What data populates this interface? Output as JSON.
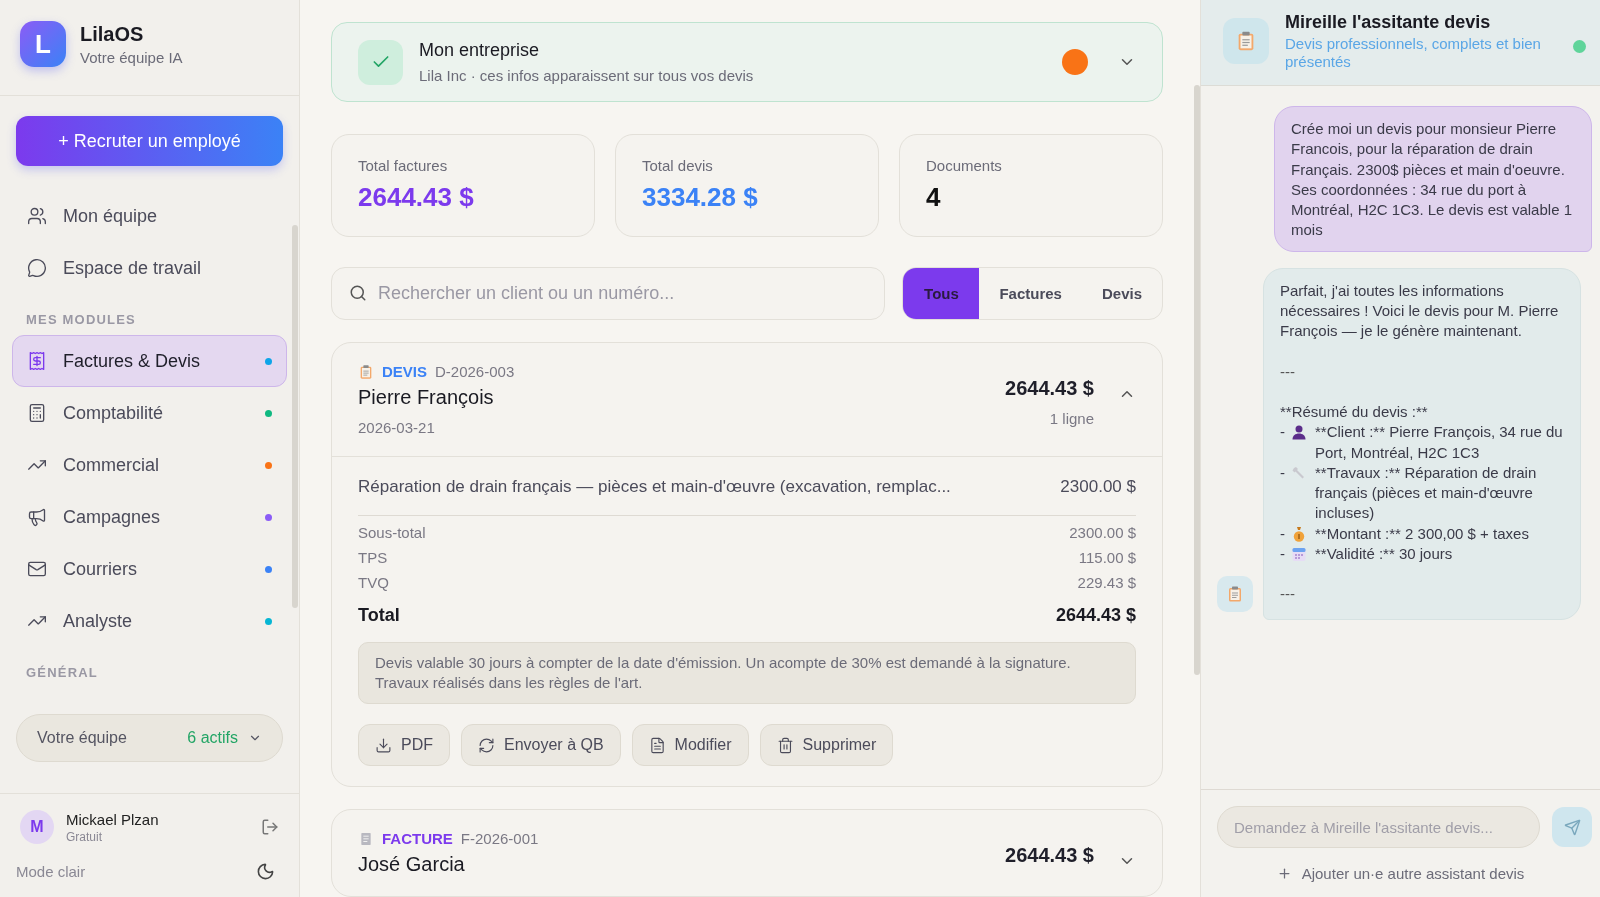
{
  "brand": {
    "logo_letter": "L",
    "name": "LilaOS",
    "tagline": "Votre équipe IA"
  },
  "recruit_button": "+ Recruter un employé",
  "nav": [
    {
      "kind": "users",
      "label": "Mon équipe"
    },
    {
      "kind": "chat",
      "label": "Espace de travail"
    }
  ],
  "modules": {
    "heading": "MES MODULES",
    "items": [
      {
        "kind": "invoice",
        "label": "Factures & Devis",
        "selected": true,
        "color": "#0ea5e9"
      },
      {
        "kind": "calculator",
        "label": "Comptabilité",
        "selected": false,
        "color": "#10b981"
      },
      {
        "kind": "trend",
        "label": "Commercial",
        "selected": false,
        "color": "#f97316"
      },
      {
        "kind": "megaphone",
        "label": "Campagnes",
        "selected": false,
        "color": "#8b5cf6"
      },
      {
        "kind": "mail",
        "label": "Courriers",
        "selected": false,
        "color": "#3b82f6"
      },
      {
        "kind": "trend",
        "label": "Analyste",
        "selected": false,
        "color": "#06b6d4"
      }
    ]
  },
  "general_heading": "GÉNÉRAL",
  "team": {
    "label": "Votre équipe",
    "count": "6 actifs"
  },
  "user": {
    "initial": "M",
    "name": "Mickael Plzan",
    "plan": "Gratuit"
  },
  "mode": {
    "label": "Mode clair"
  },
  "company": {
    "title": "Mon entreprise",
    "subtitle": "Lila Inc · ces infos apparaissent sur tous vos devis"
  },
  "stats": [
    {
      "label": "Total factures",
      "value": "2644.43 $",
      "color": "#7c3aed"
    },
    {
      "label": "Total devis",
      "value": "3334.28 $",
      "color": "#3b82f6"
    },
    {
      "label": "Documents",
      "value": "4",
      "color": "#111111"
    }
  ],
  "search": {
    "placeholder": "Rechercher un client ou un numéro..."
  },
  "filters": [
    {
      "label": "Tous",
      "selected": true
    },
    {
      "label": "Factures",
      "selected": false
    },
    {
      "label": "Devis",
      "selected": false
    }
  ],
  "documents": [
    {
      "kind": "devis",
      "type_label": "DEVIS",
      "number": "D-2026-003",
      "client": "Pierre François",
      "date": "2026-03-21",
      "amount": "2644.43 $",
      "lines_count": "1 ligne",
      "expanded": true,
      "lines": [
        {
          "description": "Réparation de drain français — pièces et main-d'œuvre (excavation, remplac...",
          "amount": "2300.00 $"
        }
      ],
      "totals": [
        {
          "label": "Sous-total",
          "value": "2300.00 $"
        },
        {
          "label": "TPS",
          "value": "115.00 $"
        },
        {
          "label": "TVQ",
          "value": "229.43 $"
        }
      ],
      "total": {
        "label": "Total",
        "value": "2644.43 $"
      },
      "note": "Devis valable 30 jours à compter de la date d'émission. Un acompte de 30% est demandé à la signature. Travaux réalisés dans les règles de l'art.",
      "actions": [
        {
          "kind": "download",
          "label": "PDF"
        },
        {
          "kind": "refresh",
          "label": "Envoyer à QB"
        },
        {
          "kind": "file",
          "label": "Modifier"
        },
        {
          "kind": "trash",
          "label": "Supprimer"
        }
      ]
    },
    {
      "kind": "facture",
      "type_label": "FACTURE",
      "number": "F-2026-001",
      "client": "José Garcia",
      "amount": "2644.43 $",
      "expanded": false
    }
  ],
  "assistant": {
    "name": "Mireille l'assitante devis",
    "subtitle": "Devis professionnels, complets et bien présentés",
    "online": true
  },
  "messages": [
    {
      "kind": "user",
      "text": "Crée moi un devis pour monsieur Pierre Francois, pour la réparation de drain Français. 2300$ pièces et main d'oeuvre. Ses coordonnées : 34 rue du port à Montréal, H2C 1C3. Le devis est valable 1 mois"
    },
    {
      "kind": "assistant",
      "blocks": [
        {
          "kind": "text",
          "text": "Parfait, j'ai toutes les informations nécessaires ! Voici le devis pour M. Pierre François — je le génère maintenant."
        },
        {
          "kind": "rule",
          "text": "---"
        },
        {
          "kind": "text",
          "text": "**Résumé du devis :**"
        },
        {
          "kind": "item",
          "bullet": "-",
          "text": "**Client :** Pierre François, 34 rue du Port, Montréal, H2C 1C3"
        },
        {
          "kind": "item",
          "bullet": "-",
          "text": "**Travaux :** Réparation de drain français (pièces et main-d'œuvre incluses)"
        },
        {
          "kind": "item",
          "bullet": "-",
          "text": "**Montant :** 2 300,00 $ + taxes"
        },
        {
          "kind": "item",
          "bullet": "-",
          "text": "**Validité :** 30 jours"
        },
        {
          "kind": "rule",
          "text": "---"
        }
      ]
    }
  ],
  "chat_input": {
    "placeholder": "Demandez à Mireille l'assitante devis..."
  },
  "add_assistant": "Ajouter un·e autre assistant devis"
}
